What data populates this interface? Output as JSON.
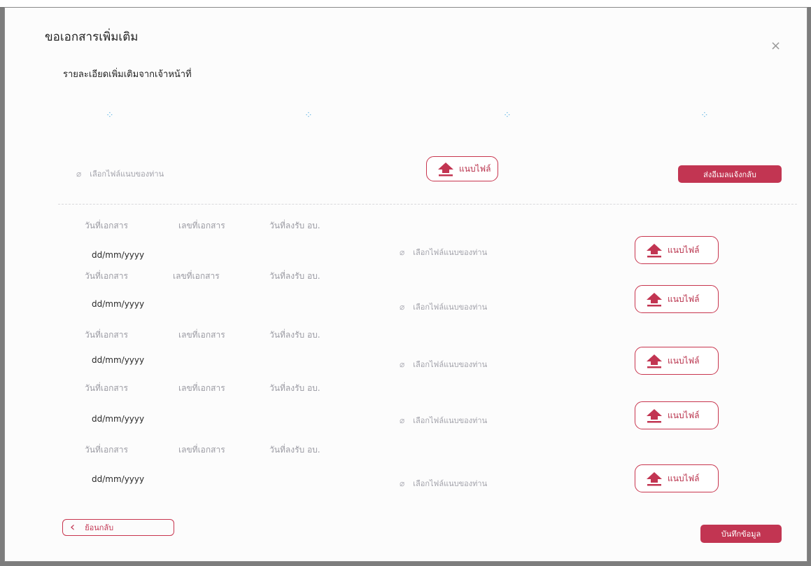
{
  "modal": {
    "title": "ขอเอกสารเพิ่มเติม",
    "subtitle": "รายละเอียดเพิ่มเติมจากเจ้าหน้าที่",
    "close_symbol": "×"
  },
  "loading_icons": [
    "loading-icon",
    "loading-icon",
    "loading-icon",
    "loading-icon"
  ],
  "top_section": {
    "file_placeholder": "เลือกไฟล์แนบของท่าน",
    "upload_label": "แนบไฟล์",
    "email_button": "ส่งอีเมลแจ้งกลับ"
  },
  "columns": {
    "doc_date": "วันที่เอกสาร",
    "doc_number": "เลขที่เอกสาร",
    "received_date": "วันที่ลงรับ อบ."
  },
  "rows": [
    {
      "date_placeholder": "dd/mm/yyyy",
      "file_placeholder": "เลือกไฟล์แนบของท่าน",
      "upload_label": "แนบไฟล์"
    },
    {
      "date_placeholder": "dd/mm/yyyy",
      "file_placeholder": "เลือกไฟล์แนบของท่าน",
      "upload_label": "แนบไฟล์"
    },
    {
      "date_placeholder": "dd/mm/yyyy",
      "file_placeholder": "เลือกไฟล์แนบของท่าน",
      "upload_label": "แนบไฟล์"
    },
    {
      "date_placeholder": "dd/mm/yyyy",
      "file_placeholder": "เลือกไฟล์แนบของท่าน",
      "upload_label": "แนบไฟล์"
    },
    {
      "date_placeholder": "dd/mm/yyyy",
      "file_placeholder": "เลือกไฟล์แนบของท่าน",
      "upload_label": "แนบไฟล์"
    }
  ],
  "footer": {
    "back_label": "ย้อนกลับ",
    "save_label": "บันทึกข้อมูล"
  },
  "colors": {
    "accent": "#c23552",
    "overlay": "#7d7d7d"
  }
}
